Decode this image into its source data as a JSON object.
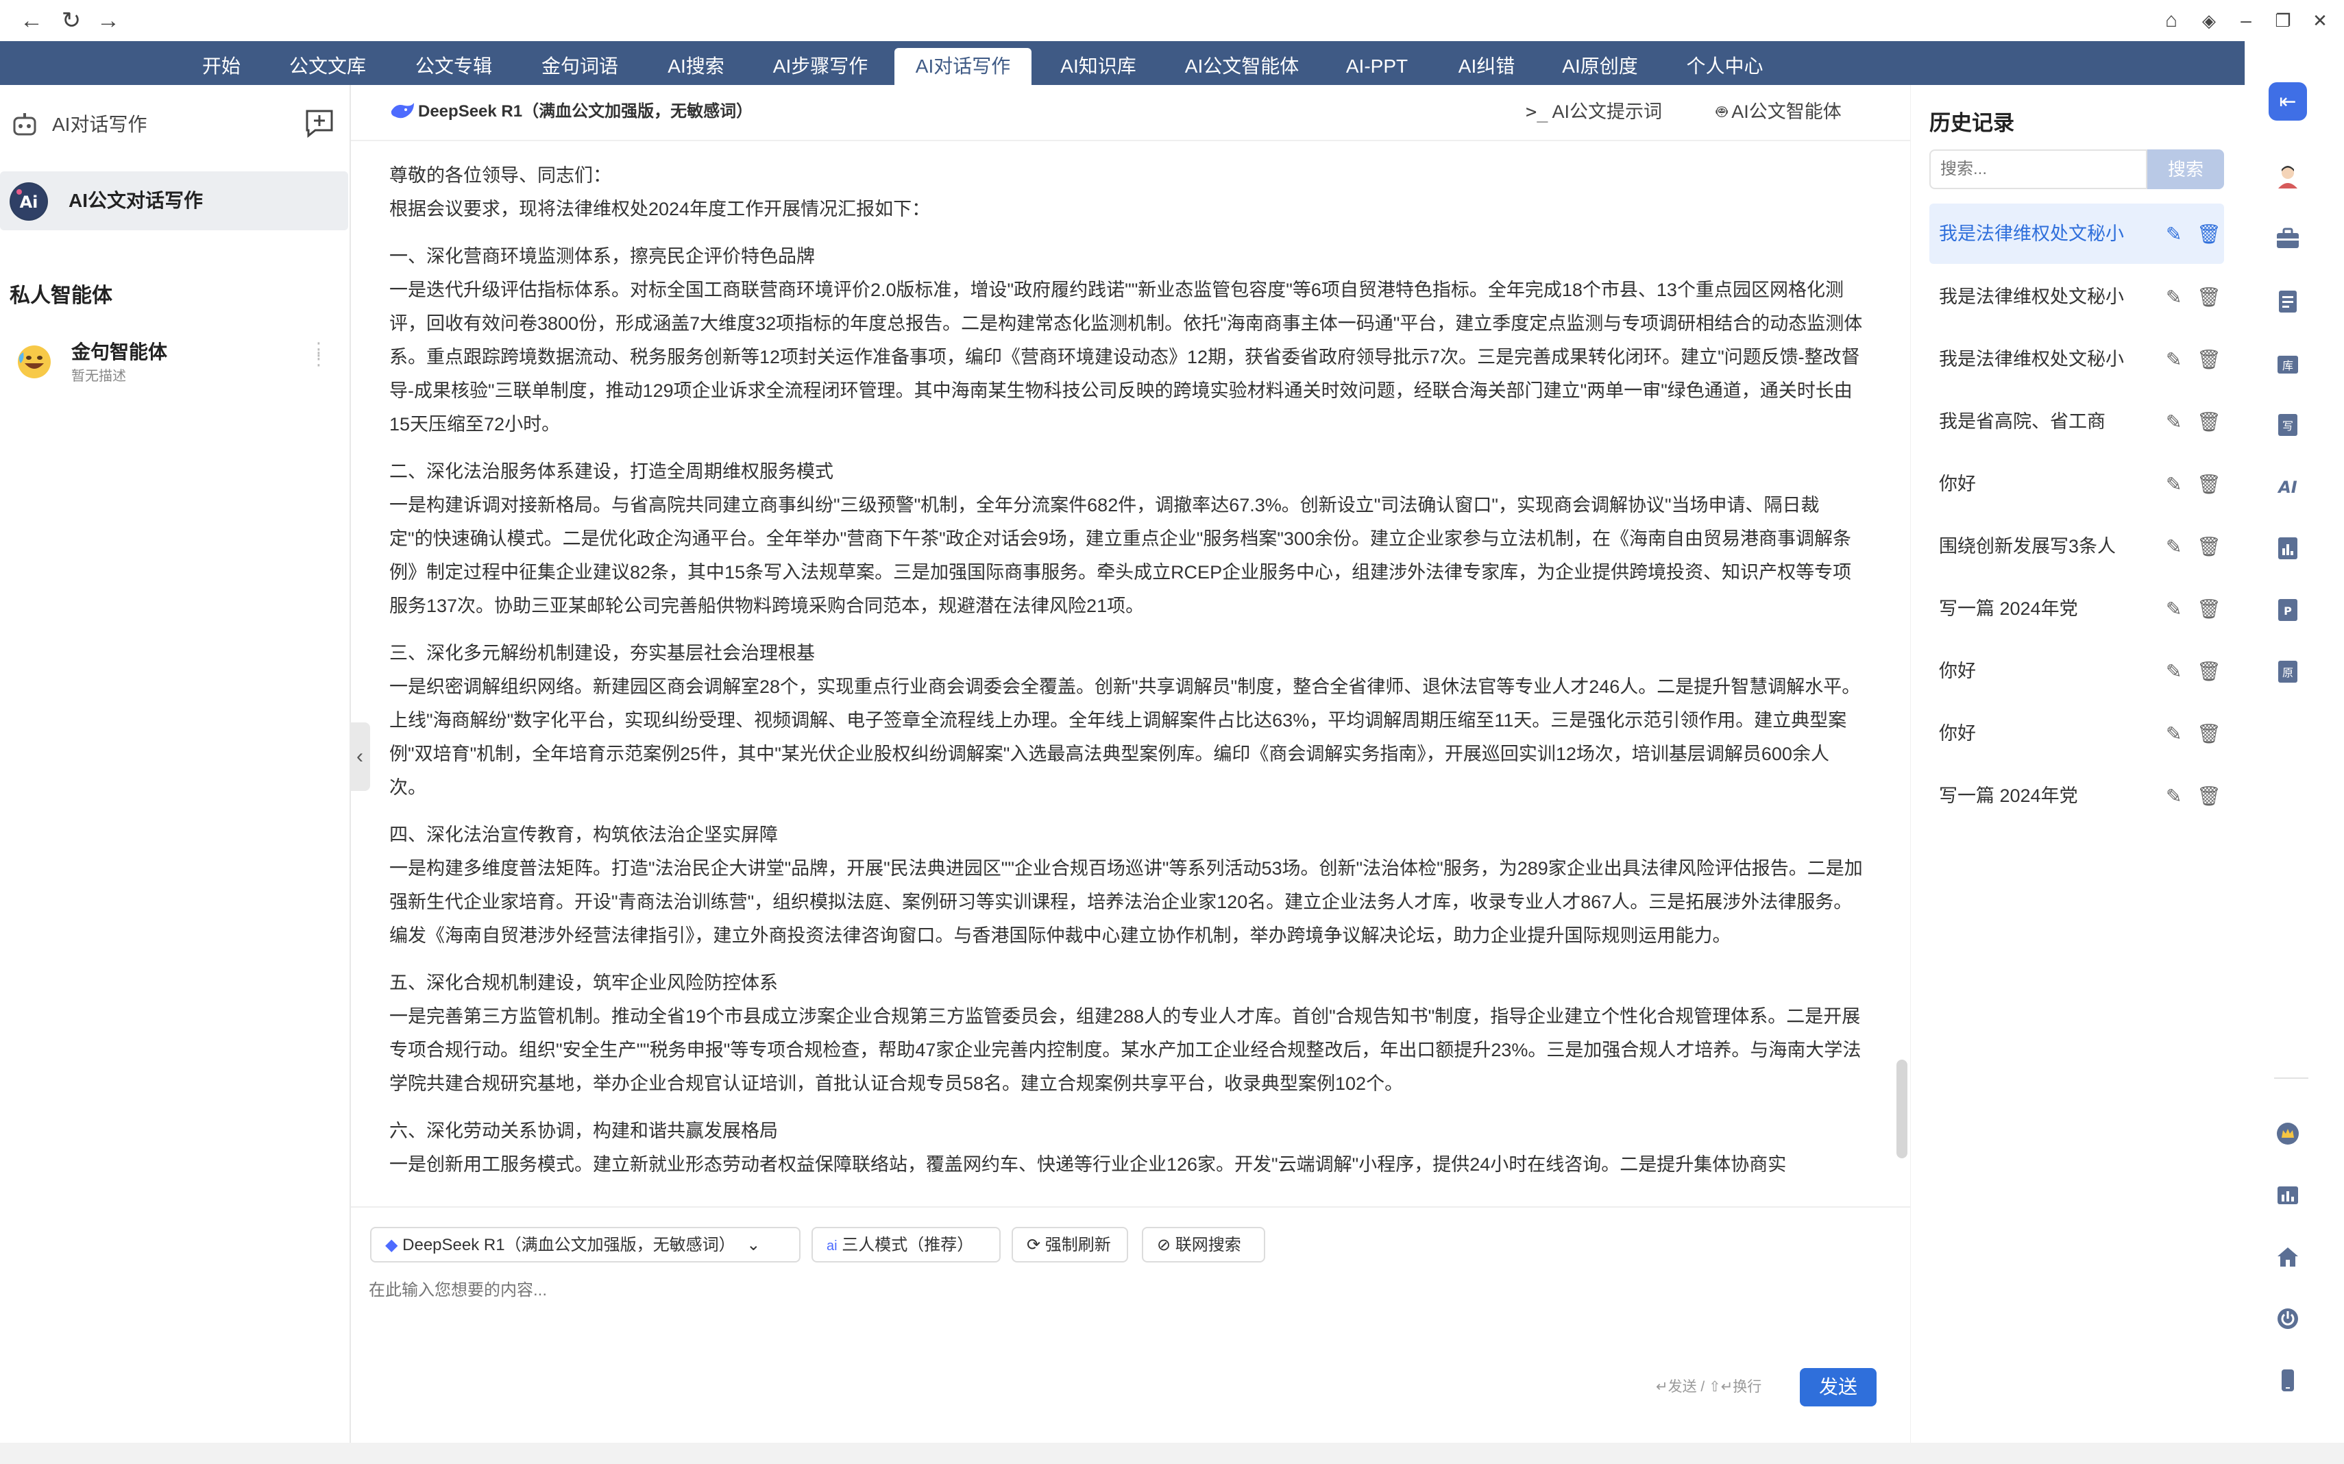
{
  "titlebar": {
    "back": "←",
    "reload": "↻",
    "forward": "→",
    "home": "⌂",
    "min": "–",
    "max": "❐",
    "close": "✕"
  },
  "nav": {
    "tabs": [
      "开始",
      "公文文库",
      "公文专辑",
      "金句词语",
      "AI搜索",
      "AI步骤写作",
      "AI对话写作",
      "AI知识库",
      "AI公文智能体",
      "AI-PPT",
      "AI纠错",
      "AI原创度",
      "个人中心"
    ],
    "active": "AI对话写作"
  },
  "leftbar": {
    "header_title": "AI对话写作",
    "new_chat_icon": "chat-add-icon",
    "selected_item": "AI公文对话写作",
    "private_section": "私人智能体",
    "agent_name": "金句智能体",
    "agent_desc": "暂无描述"
  },
  "topbar": {
    "model": "DeepSeek R1（满血公文加强版，无敏感词）",
    "prompt_link": "AI公文提示词",
    "agent_link": "AI公文智能体"
  },
  "content": {
    "greeting": "尊敬的各位领导、同志们：",
    "intro": "根据会议要求，现将法律维权处2024年度工作开展情况汇报如下：",
    "sections": [
      {
        "heading": "一、深化营商环境监测体系，擦亮民企评价特色品牌",
        "body": "一是迭代升级评估指标体系。对标全国工商联营商环境评价2.0版标准，增设\"政府履约践诺\"\"新业态监管包容度\"等6项自贸港特色指标。全年完成18个市县、13个重点园区网格化测评，回收有效问卷3800份，形成涵盖7大维度32项指标的年度总报告。二是构建常态化监测机制。依托\"海南商事主体一码通\"平台，建立季度定点监测与专项调研相结合的动态监测体系。重点跟踪跨境数据流动、税务服务创新等12项封关运作准备事项，编印《营商环境建设动态》12期，获省委省政府领导批示7次。三是完善成果转化闭环。建立\"问题反馈-整改督导-成果核验\"三联单制度，推动129项企业诉求全流程闭环管理。其中海南某生物科技公司反映的跨境实验材料通关时效问题，经联合海关部门建立\"两单一审\"绿色通道，通关时长由15天压缩至72小时。"
      },
      {
        "heading": "二、深化法治服务体系建设，打造全周期维权服务模式",
        "body": "一是构建诉调对接新格局。与省高院共同建立商事纠纷\"三级预警\"机制，全年分流案件682件，调撤率达67.3%。创新设立\"司法确认窗口\"，实现商会调解协议\"当场申请、隔日裁定\"的快速确认模式。二是优化政企沟通平台。全年举办\"营商下午茶\"政企对话会9场，建立重点企业\"服务档案\"300余份。建立企业家参与立法机制，在《海南自由贸易港商事调解条例》制定过程中征集企业建议82条，其中15条写入法规草案。三是加强国际商事服务。牵头成立RCEP企业服务中心，组建涉外法律专家库，为企业提供跨境投资、知识产权等专项服务137次。协助三亚某邮轮公司完善船供物料跨境采购合同范本，规避潜在法律风险21项。"
      },
      {
        "heading": "三、深化多元解纷机制建设，夯实基层社会治理根基",
        "body": "一是织密调解组织网络。新建园区商会调解室28个，实现重点行业商会调委会全覆盖。创新\"共享调解员\"制度，整合全省律师、退休法官等专业人才246人。二是提升智慧调解水平。上线\"海商解纷\"数字化平台，实现纠纷受理、视频调解、电子签章全流程线上办理。全年线上调解案件占比达63%，平均调解周期压缩至11天。三是强化示范引领作用。建立典型案例\"双培育\"机制，全年培育示范案例25件，其中\"某光伏企业股权纠纷调解案\"入选最高法典型案例库。编印《商会调解实务指南》，开展巡回实训12场次，培训基层调解员600余人次。"
      },
      {
        "heading": "四、深化法治宣传教育，构筑依法治企坚实屏障",
        "body": "一是构建多维度普法矩阵。打造\"法治民企大讲堂\"品牌，开展\"民法典进园区\"\"企业合规百场巡讲\"等系列活动53场。创新\"法治体检\"服务，为289家企业出具法律风险评估报告。二是加强新生代企业家培育。开设\"青商法治训练营\"，组织模拟法庭、案例研习等实训课程，培养法治企业家120名。建立企业法务人才库，收录专业人才867人。三是拓展涉外法律服务。编发《海南自贸港涉外经营法律指引》，建立外商投资法律咨询窗口。与香港国际仲裁中心建立协作机制，举办跨境争议解决论坛，助力企业提升国际规则运用能力。"
      },
      {
        "heading": "五、深化合规机制建设，筑牢企业风险防控体系",
        "body": "一是完善第三方监管机制。推动全省19个市县成立涉案企业合规第三方监管委员会，组建288人的专业人才库。首创\"合规告知书\"制度，指导企业建立个性化合规管理体系。二是开展专项合规行动。组织\"安全生产\"\"税务申报\"等专项合规检查，帮助47家企业完善内控制度。某水产加工企业经合规整改后，年出口额提升23%。三是加强合规人才培养。与海南大学法学院共建合规研究基地，举办企业合规官认证培训，首批认证合规专员58名。建立合规案例共享平台，收录典型案例102个。"
      },
      {
        "heading": "六、深化劳动关系协调，构建和谐共赢发展格局",
        "body": "一是创新用工服务模式。建立新就业形态劳动者权益保障联络站，覆盖网约车、快递等行业企业126家。开发\"云端调解\"小程序，提供24小时在线咨询。二是提升集体协商实"
      }
    ]
  },
  "composer": {
    "model_pill": "DeepSeek R1（满血公文加强版，无敏感词）",
    "mode_pill": "三人模式（推荐）",
    "refresh_pill": "强制刷新",
    "web_pill": "联网搜索",
    "placeholder": "在此输入您想要的内容...",
    "hint": "↵发送 / ⇧↵换行",
    "send": "发送"
  },
  "history": {
    "title": "历史记录",
    "search_placeholder": "搜索...",
    "search_button": "搜索",
    "items": [
      "我是法律维权处文秘小",
      "我是法律维权处文秘小",
      "我是法律维权处文秘小",
      "我是省高院、省工商",
      "你好",
      "围绕创新发展写3条人",
      "写一篇 2024年党",
      "你好",
      "你好",
      "写一篇 2024年党"
    ]
  },
  "colors": {
    "nav_bg": "#3f5a85",
    "accent": "#2f6fdb",
    "selected_bg": "#e8f0fd"
  }
}
